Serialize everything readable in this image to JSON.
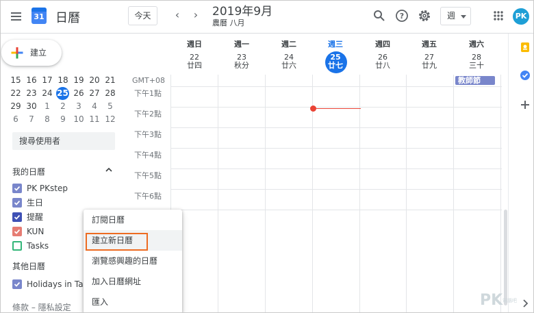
{
  "header": {
    "app_icon_day": "31",
    "app_title": "日曆",
    "today_button": "今天",
    "prev_arrow": "‹",
    "next_arrow": "›",
    "date_title": "2019年9月",
    "lunar_title": "農曆 八月",
    "view_select": "週",
    "avatar_initials": "PK"
  },
  "create_button": {
    "label": "建立"
  },
  "mini_calendar": {
    "rows": [
      [
        {
          "d": "15",
          "t": ""
        },
        {
          "d": "16",
          "t": ""
        },
        {
          "d": "17",
          "t": ""
        },
        {
          "d": "18",
          "t": ""
        },
        {
          "d": "19",
          "t": ""
        },
        {
          "d": "20",
          "t": ""
        },
        {
          "d": "21",
          "t": ""
        }
      ],
      [
        {
          "d": "22",
          "t": ""
        },
        {
          "d": "23",
          "t": ""
        },
        {
          "d": "24",
          "t": ""
        },
        {
          "d": "25",
          "t": "today"
        },
        {
          "d": "26",
          "t": ""
        },
        {
          "d": "27",
          "t": ""
        },
        {
          "d": "28",
          "t": ""
        }
      ],
      [
        {
          "d": "29",
          "t": ""
        },
        {
          "d": "30",
          "t": ""
        },
        {
          "d": "1",
          "t": "other"
        },
        {
          "d": "2",
          "t": "other"
        },
        {
          "d": "3",
          "t": "other"
        },
        {
          "d": "4",
          "t": "other"
        },
        {
          "d": "5",
          "t": "other"
        }
      ],
      [
        {
          "d": "6",
          "t": "other"
        },
        {
          "d": "7",
          "t": "other"
        },
        {
          "d": "8",
          "t": "other"
        },
        {
          "d": "9",
          "t": "other"
        },
        {
          "d": "10",
          "t": "other"
        },
        {
          "d": "11",
          "t": "other"
        },
        {
          "d": "12",
          "t": "other"
        }
      ]
    ]
  },
  "sidebar": {
    "search_people": "搜尋使用者",
    "my_calendars_title": "我的日曆",
    "my_calendars": [
      {
        "label": "PK PKstep",
        "color": "#7986cb",
        "checked": true
      },
      {
        "label": "生日",
        "color": "#7986cb",
        "checked": true
      },
      {
        "label": "提醒",
        "color": "#3f51b5",
        "checked": true
      },
      {
        "label": "KUN",
        "color": "#e67c73",
        "checked": true
      },
      {
        "label": "Tasks",
        "color": "#33b679",
        "checked": false
      }
    ],
    "other_calendars_title": "其他日曆",
    "other_calendars": [
      {
        "label": "Holidays in Taiwan",
        "color": "#7986cb",
        "checked": true
      }
    ],
    "footer": "條款 – 隱私設定"
  },
  "week": {
    "days": [
      {
        "name": "週日",
        "num": "22",
        "lunar": "廿四"
      },
      {
        "name": "週一",
        "num": "23",
        "lunar": "秋分"
      },
      {
        "name": "週二",
        "num": "24",
        "lunar": "廿六"
      },
      {
        "name": "週三",
        "num": "25",
        "lunar": "廿七",
        "today": true
      },
      {
        "name": "週四",
        "num": "26",
        "lunar": "廿八"
      },
      {
        "name": "週五",
        "num": "27",
        "lunar": "廿九"
      },
      {
        "name": "週六",
        "num": "28",
        "lunar": "三十"
      }
    ],
    "timezone": "GMT+08",
    "hours": [
      "下午1點",
      "下午2點",
      "下午3點",
      "下午4點",
      "下午5點",
      "下午6點"
    ],
    "all_day_event": {
      "label": "教師節",
      "day": "週六",
      "color": "#7986cb"
    }
  },
  "context_menu": {
    "items": [
      "訂閱日曆",
      "建立新日曆",
      "瀏覽感興趣的日曆",
      "加入日曆網址",
      "匯入"
    ],
    "highlighted": "建立新日曆"
  },
  "watermark": {
    "main": "PK",
    "sub": "電腦吧"
  },
  "colors": {
    "accent": "#1a73e8",
    "highlight_border": "#ed6b21",
    "now_line": "#ea4335"
  }
}
